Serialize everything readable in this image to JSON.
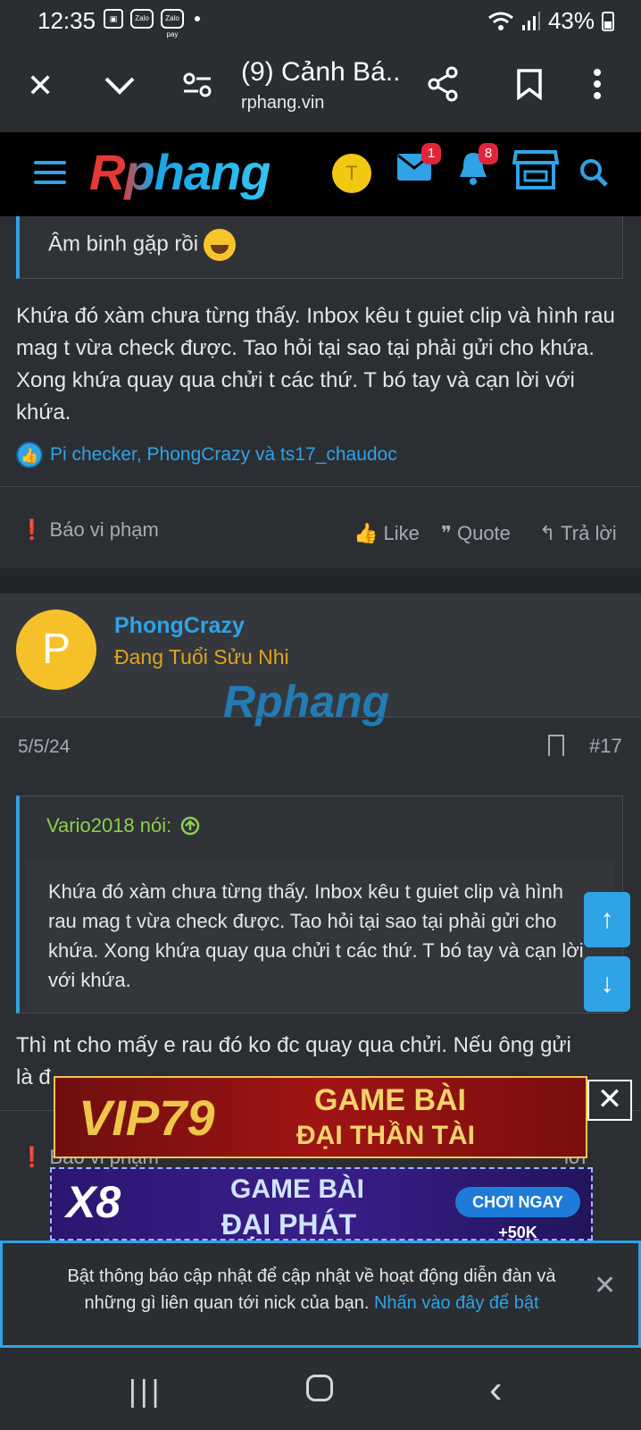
{
  "status_bar": {
    "time": "12:35",
    "battery": "43%",
    "icons": [
      "gallery-icon",
      "zalo-icon",
      "zalo-pay-icon",
      "wifi-icon",
      "signal-icon",
      "battery-icon"
    ],
    "zalo": "Zalo",
    "zalo_pay": "Zalo pay"
  },
  "browser": {
    "tab_title": "(9) Cảnh Bá...",
    "url": "rphang.vin"
  },
  "site_header": {
    "logo": "Rphang",
    "user_initial": "T",
    "inbox_badge": "1",
    "alerts_badge": "8"
  },
  "post1": {
    "quote_text": "Âm binh gặp rồi",
    "body": "Khứa đó xàm chưa từng thấy. Inbox kêu t guiet clip và hình rau mag t vừa check được. Tao hỏi tại sao tại phải gửi cho khứa. Xong khứa quay qua chửi t các thứ. T bó tay và cạn lời với khứa.",
    "reactions": "Pi checker, PhongCrazy và ts17_chaudoc",
    "actions": {
      "report": "Báo vi phạm",
      "like": "Like",
      "quote": "Quote",
      "reply": "Trả lời"
    }
  },
  "post2": {
    "avatar_letter": "P",
    "username": "PhongCrazy",
    "user_title": "Đang Tuổi Sửu Nhi",
    "watermark": "Rphang",
    "date": "5/5/24",
    "post_number": "#17",
    "quote_author": "Vario2018 nói:",
    "quote_text": "Khứa đó xàm chưa từng thấy. Inbox kêu t guiet clip và hình rau mag t vừa check được. Tao hỏi tại sao tại phải gửi cho khứa. Xong khứa quay qua chửi t các thứ. T bó tay và cạn lời với khứa.",
    "body_line1": "Thì nt cho mấy e rau đó ko đc quay qua chửi. Nếu ông gửi",
    "body_line2": "là đ",
    "report_partial": "Báo vi phạm",
    "reply_partial": "lời"
  },
  "ads": {
    "ad1": {
      "brand": "VIP79",
      "line1": "GAME BÀI",
      "line2": "ĐẠI THẦN TÀI"
    },
    "ad2": {
      "brand": "X8",
      "line1": "GAME BÀI",
      "line2": "ĐẠI PHÁT",
      "cta": "CHƠI NGAY +50K"
    }
  },
  "notification": {
    "text": "Bật thông báo cập nhật để cập nhật về hoạt động diễn đàn và những gì liên quan tới nick của bạn.",
    "link": "Nhấn vào đây để bật"
  },
  "colors": {
    "accent": "#2fa3e6",
    "background": "#2b2e32",
    "username": "#2fa3e6",
    "user_title": "#e0a41c",
    "quote_author": "#8fcf4f"
  }
}
